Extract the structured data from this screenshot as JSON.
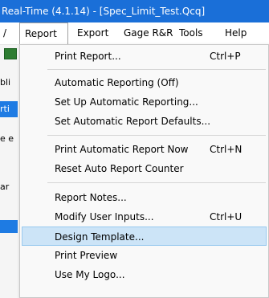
{
  "window": {
    "title": "Real-Time (4.1.14)  - [Spec_Limit_Test.Qcq]"
  },
  "menubar": {
    "items": [
      {
        "label": "/"
      },
      {
        "label": "Report"
      },
      {
        "label": "Export"
      },
      {
        "label": "Gage R&R"
      },
      {
        "label": "Tools"
      },
      {
        "label": "Help"
      }
    ]
  },
  "left_strip": {
    "fragments": [
      "bli",
      "rti",
      "e e",
      "ar"
    ]
  },
  "report_menu": {
    "groups": [
      [
        {
          "label": "Print Report...",
          "shortcut": "Ctrl+P"
        }
      ],
      [
        {
          "label": "Automatic Reporting (Off)",
          "shortcut": ""
        },
        {
          "label": "Set Up Automatic Reporting...",
          "shortcut": ""
        },
        {
          "label": "Set Automatic Report Defaults...",
          "shortcut": ""
        }
      ],
      [
        {
          "label": "Print Automatic Report Now",
          "shortcut": "Ctrl+N"
        },
        {
          "label": "Reset Auto Report Counter",
          "shortcut": ""
        }
      ],
      [
        {
          "label": "Report Notes...",
          "shortcut": ""
        },
        {
          "label": "Modify User Inputs...",
          "shortcut": "Ctrl+U"
        },
        {
          "label": "Design Template...",
          "shortcut": "",
          "highlighted": true
        },
        {
          "label": "Print Preview",
          "shortcut": ""
        },
        {
          "label": "Use My Logo...",
          "shortcut": ""
        }
      ]
    ]
  }
}
